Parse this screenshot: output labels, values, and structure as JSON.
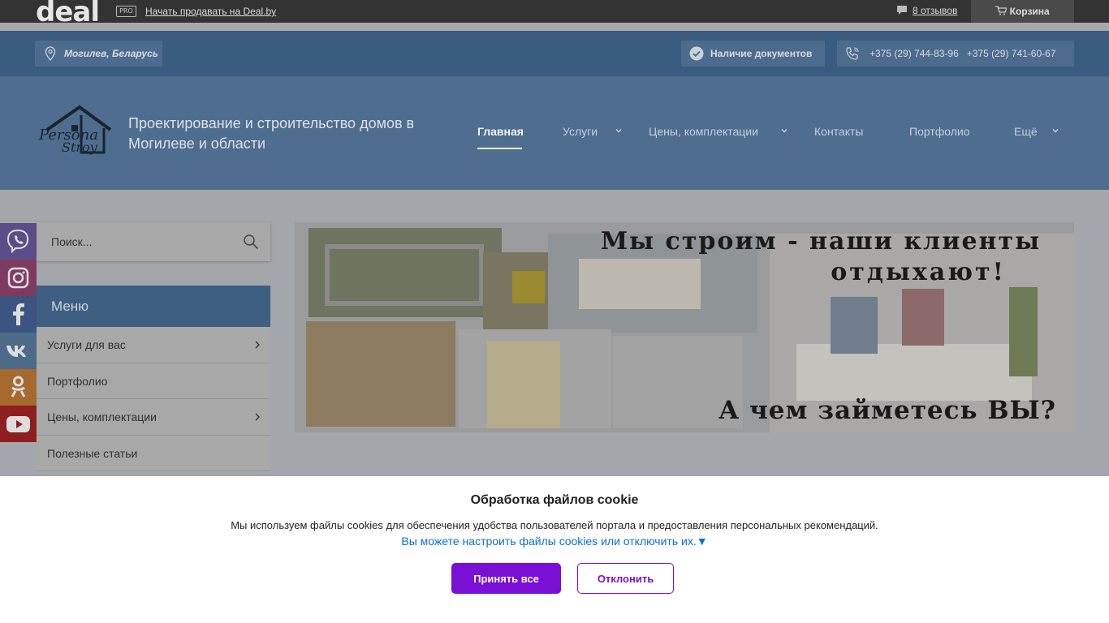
{
  "dealbar": {
    "logo": "deal",
    "pro": "PRO",
    "sell_link": "Начать продавать на Deal.by",
    "reviews": "8 отзывов",
    "cart": "Корзина"
  },
  "contacts": {
    "location": "Могилев, Беларусь",
    "documents": "Наличие документов",
    "phone1": "+375 (29) 744-83-96",
    "phone2": "+375 (29) 741-60-67"
  },
  "header": {
    "logo_line1": "Persona",
    "logo_line2": "Stroy",
    "tagline": "Проектирование и строительство домов в Могилеве и области",
    "nav": [
      {
        "label": "Главная",
        "active": true
      },
      {
        "label": "Услуги"
      },
      {
        "label": "Цены, комплектации"
      },
      {
        "label": "Контакты"
      },
      {
        "label": "Портфолио"
      },
      {
        "label": "Ещё"
      }
    ]
  },
  "search": {
    "placeholder": "Поиск..."
  },
  "menu": {
    "title": "Меню",
    "items": [
      {
        "label": "Услуги для вас"
      },
      {
        "label": "Портфолио"
      },
      {
        "label": "Цены, комплектации"
      },
      {
        "label": "Полезные статьи"
      }
    ]
  },
  "banner": {
    "headline1": "Мы строим - наши клиенты",
    "headline2": "отдыхают!",
    "bottom": "А чем займетесь ВЫ?"
  },
  "social": [
    "viber-icon",
    "instagram-icon",
    "facebook-icon",
    "vk-icon",
    "odnoklassniki-icon",
    "youtube-icon"
  ],
  "cookie": {
    "title": "Обработка файлов cookie",
    "text": "Мы используем файлы cookies для обеспечения удобства пользователей портала и предоставления персональных рекомендаций.",
    "settings_link": "Вы можете настроить файлы cookies или отключить их.▼",
    "accept": "Принять все",
    "decline": "Отклонить"
  },
  "colors": {
    "accent_purple": "#7a0fd6",
    "link_blue": "#0b6fd1",
    "header_blue": "#3a5c80"
  }
}
